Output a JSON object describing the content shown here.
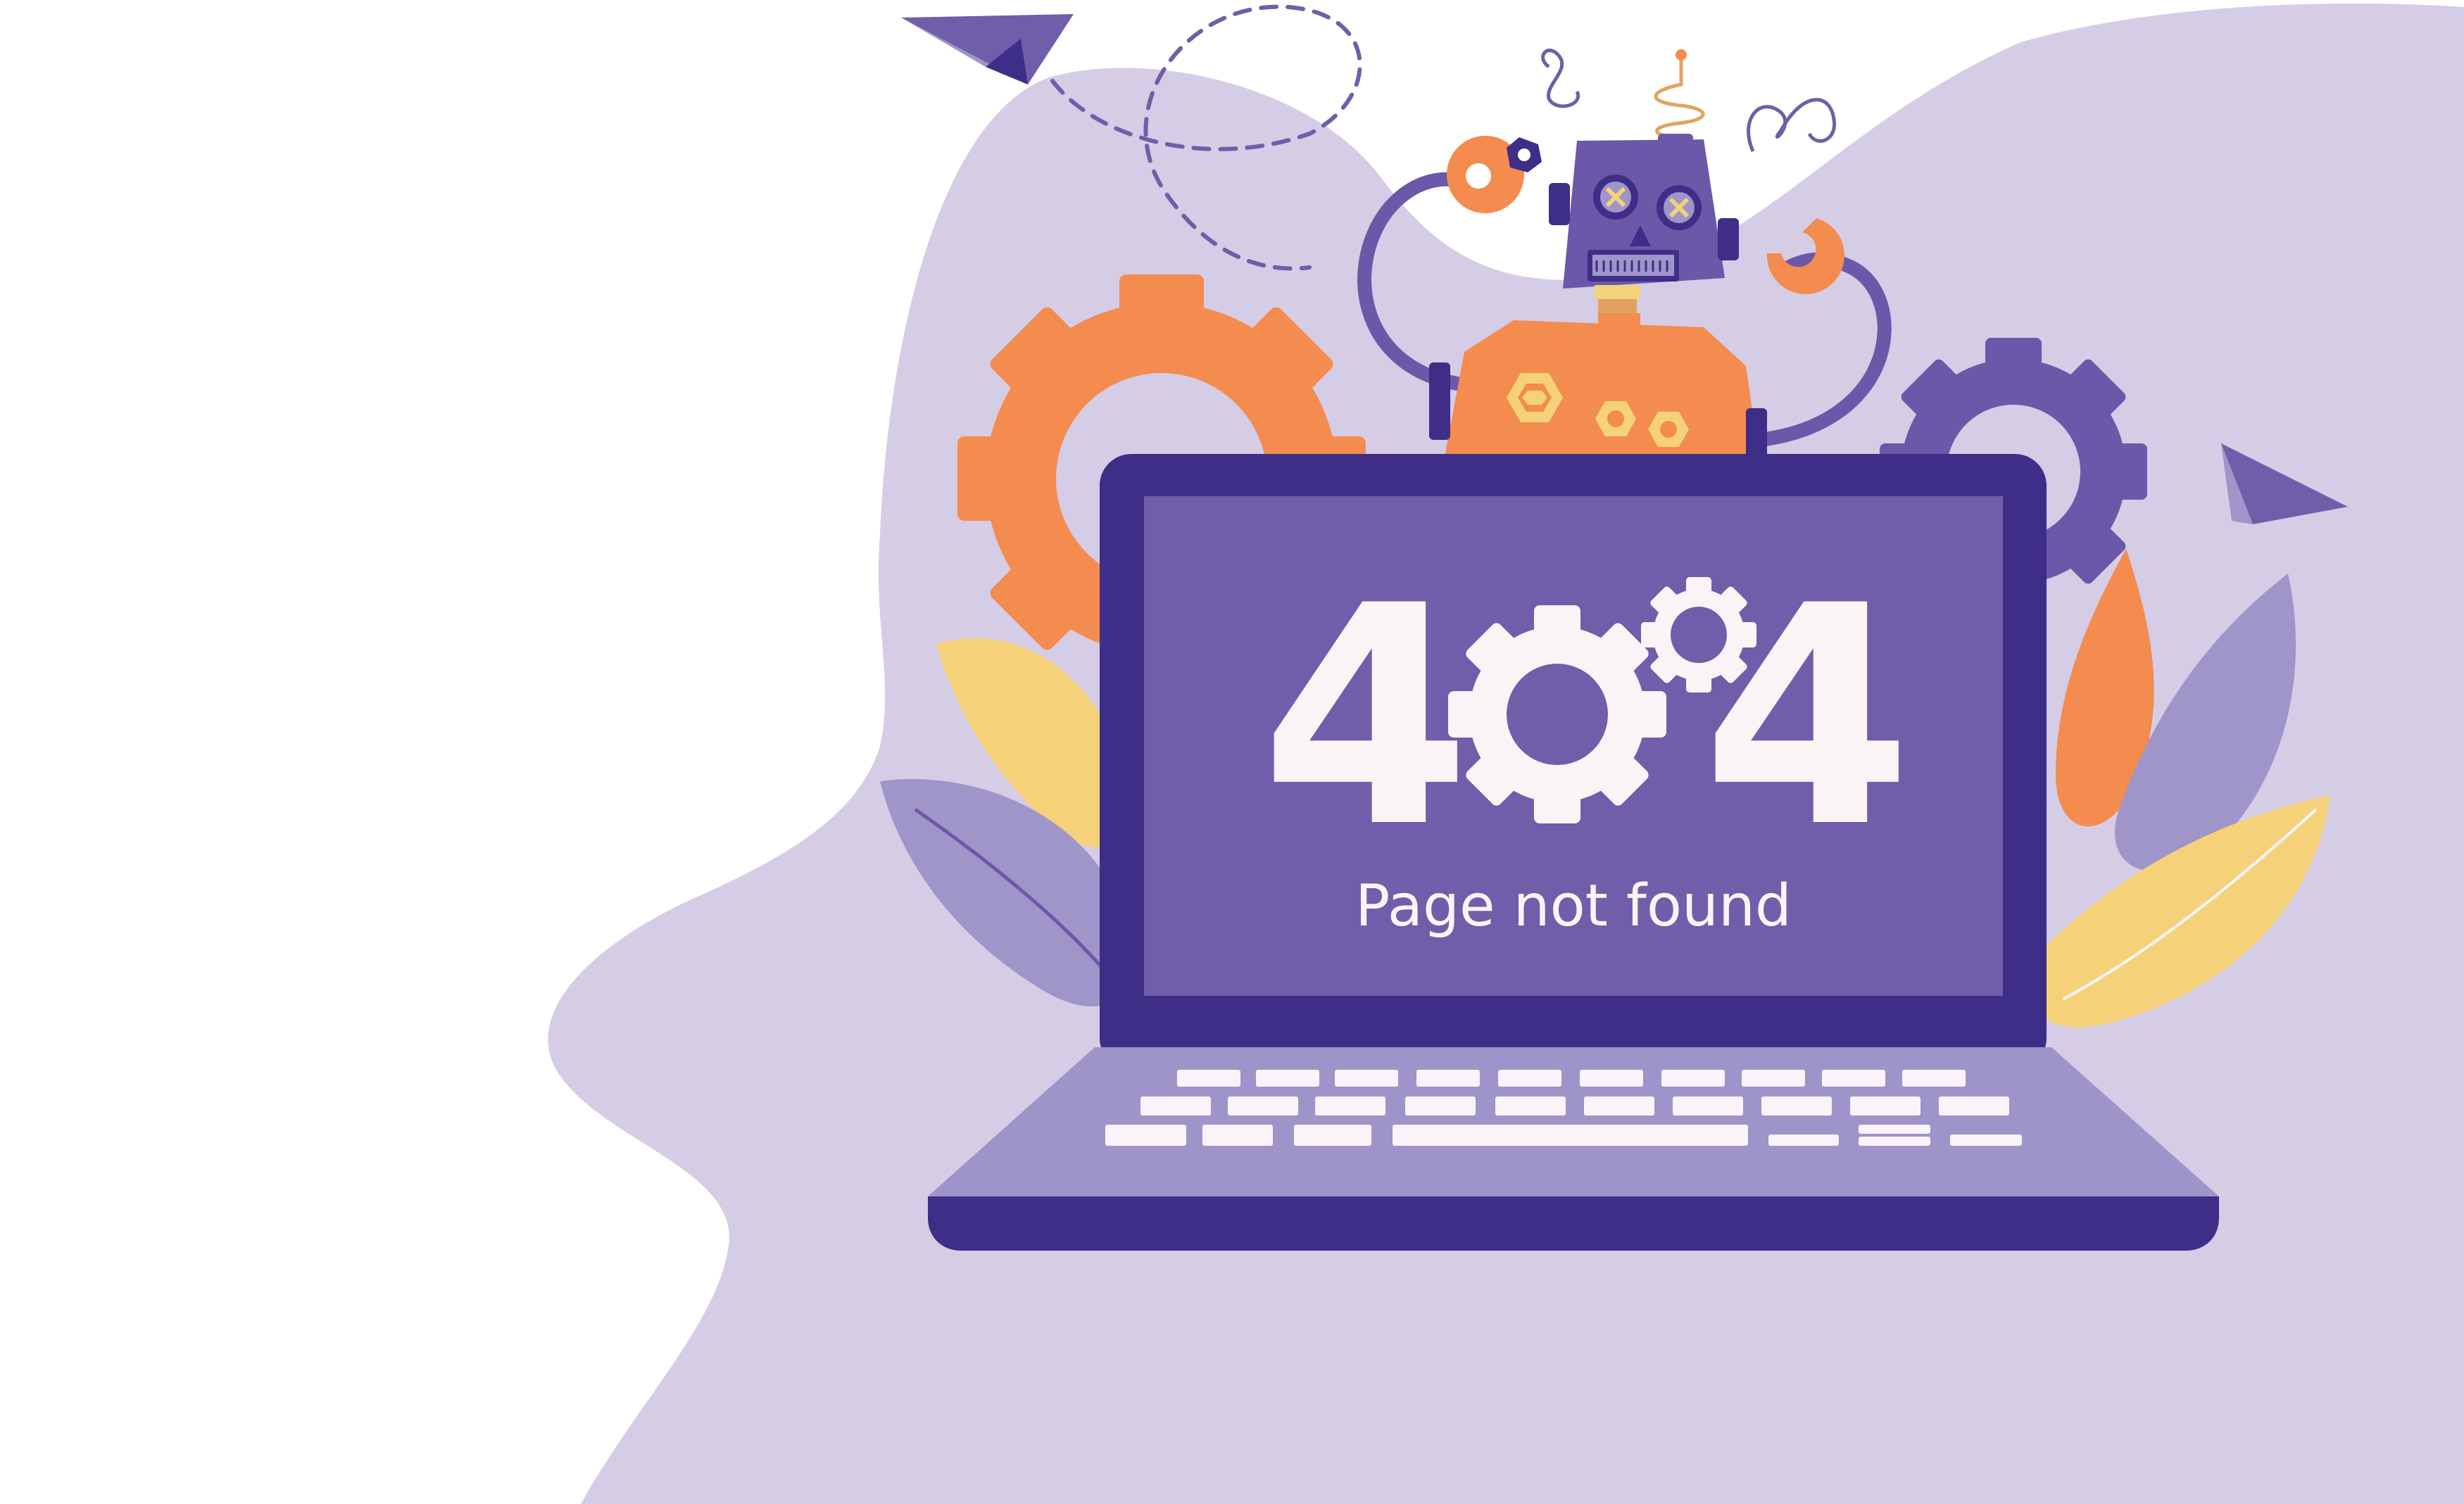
{
  "error": {
    "code_first_digit": "4",
    "code_last_digit": "4",
    "message": "Page not found"
  },
  "icons": {
    "center_zero": "gear-icon",
    "small_gear": "gear-icon",
    "robot": "robot-icon",
    "plane": "paper-plane-icon"
  },
  "colors": {
    "background_blob": "#d5cce6",
    "laptop_frame": "#3e2e88",
    "laptop_screen": "#6f5ea9",
    "laptop_base": "#9e94c9",
    "key_color": "#f8f4fa",
    "text_color": "#fbf4f7",
    "orange": "#f48b4f",
    "yellow": "#f5d27a",
    "violet": "#6b58a8",
    "light_violet": "#9f95c9"
  }
}
